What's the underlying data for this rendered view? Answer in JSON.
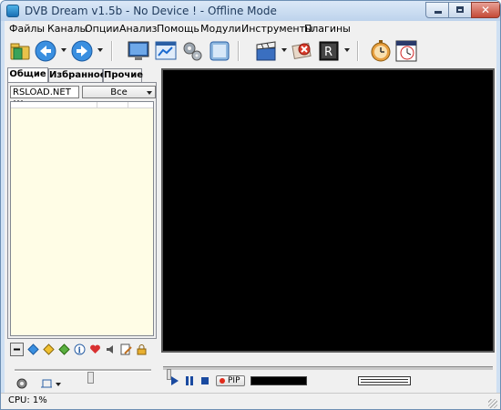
{
  "window": {
    "title": "DVB Dream v1.5b - No Device ! - Offline Mode"
  },
  "menu": [
    "Файлы",
    "Каналы",
    "Опции",
    "Анализ",
    "Помощь",
    "Модули",
    "Инструменты",
    "Плагины"
  ],
  "toolbar": {
    "icons": [
      "open-folder-icon",
      "back-icon",
      "forward-icon",
      "monitor-icon",
      "window-icon",
      "settings-gears-icon",
      "epg-icon",
      "clapperboard-icon",
      "cancel-icon",
      "record-icon",
      "timer-icon",
      "clock-calendar-icon"
    ]
  },
  "tabs": [
    "Общие",
    "Избранное",
    "Прочие"
  ],
  "filter": {
    "value": "RSLOAD.NET !!!",
    "select_value": "Все"
  },
  "left_actions": [
    "collapse-icon",
    "info-blue-icon",
    "up-down-yellow-icon",
    "up-down-green-icon",
    "info-icon",
    "heart-icon",
    "sound-icon",
    "edit-icon",
    "lock-icon"
  ],
  "player": {
    "pip_label": "PIP"
  },
  "status": {
    "cpu": "CPU: 1%"
  },
  "colors": {
    "video_bg": "#000000",
    "channel_list_bg": "#fffde6",
    "title_text": "#1e395b",
    "record_dot": "#e02a1a"
  }
}
